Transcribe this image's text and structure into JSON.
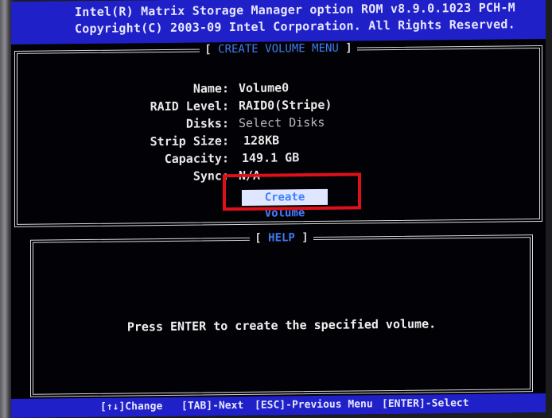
{
  "header": {
    "line1": "Intel(R) Matrix Storage Manager option ROM v8.9.0.1023 PCH-M",
    "line2": "Copyright(C) 2003-09 Intel Corporation.  All Rights Reserved."
  },
  "create_menu": {
    "title": "CREATE VOLUME MENU",
    "bracket_open": "[",
    "bracket_close": "]",
    "fields": [
      {
        "label": "Name:",
        "value": "Volume0"
      },
      {
        "label": "RAID Level:",
        "value": "RAID0(Stripe)"
      },
      {
        "label": "Disks:",
        "value": "Select Disks"
      },
      {
        "label": "Strip Size:",
        "value": "128KB"
      },
      {
        "label": "Capacity:",
        "value": "149.1  GB"
      },
      {
        "label": "Sync:",
        "value": "N/A"
      }
    ],
    "create_button": "Create Volume"
  },
  "help": {
    "title": "HELP",
    "bracket_open": "[",
    "bracket_close": "]",
    "text": "Press ENTER to create the specified volume."
  },
  "footer": {
    "change": "[↑↓]Change",
    "next": "[TAB]-Next",
    "previous": "[ESC]-Previous Menu",
    "select": "[ENTER]-Select"
  },
  "colors": {
    "header_bg": "#2020c8",
    "screen_bg": "#020206",
    "highlight": "#e0101a",
    "accent_text": "#3e7cf0"
  }
}
